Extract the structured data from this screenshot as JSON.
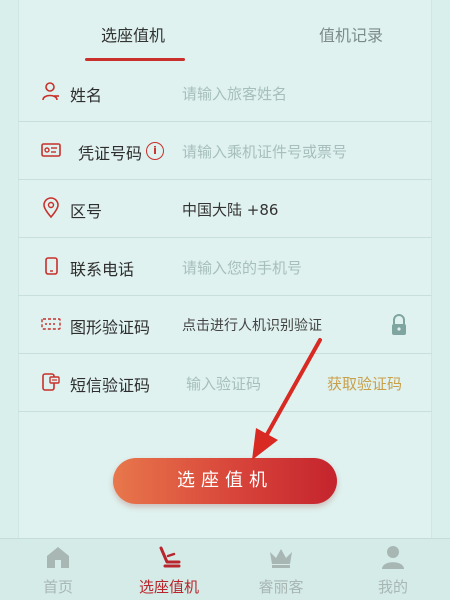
{
  "tabs": {
    "active": "选座值机",
    "record": "值机记录"
  },
  "form": {
    "name": {
      "label": "姓名",
      "placeholder": "请输入旅客姓名"
    },
    "id": {
      "label": "凭证号码",
      "info": "i",
      "placeholder": "请输入乘机证件号或票号"
    },
    "area": {
      "label": "区号",
      "value": "中国大陆 +86"
    },
    "phone": {
      "label": "联系电话",
      "placeholder": "请输入您的手机号"
    },
    "captcha": {
      "label": "图形验证码",
      "hint": "点击进行人机识别验证"
    },
    "sms": {
      "label": "短信验证码",
      "placeholder": "输入验证码",
      "get_code": "获取验证码"
    }
  },
  "submit": {
    "label": "选座值机"
  },
  "tabbar": {
    "items": [
      {
        "label": "首页",
        "icon": "home-icon"
      },
      {
        "label": "选座值机",
        "icon": "seat-icon"
      },
      {
        "label": "睿丽客",
        "icon": "crown-icon"
      },
      {
        "label": "我的",
        "icon": "user-icon"
      }
    ]
  },
  "colors": {
    "accent": "#c9302c",
    "background": "#dff2ef",
    "gold": "#c9a04a"
  }
}
